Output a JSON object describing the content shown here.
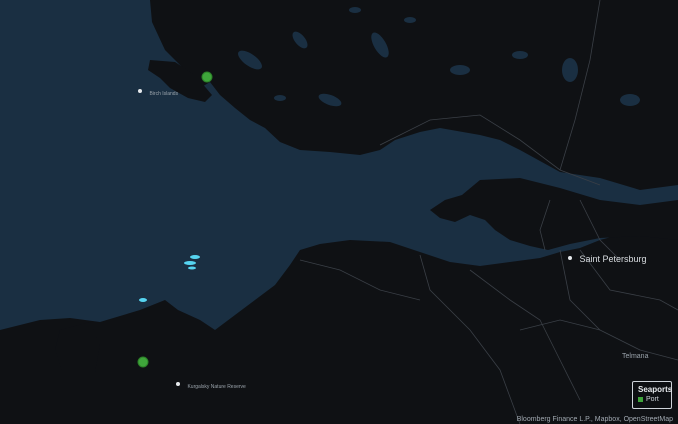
{
  "places": [
    {
      "id": "birch-islands",
      "label": "Birch Islands",
      "size": "small"
    },
    {
      "id": "kurgalsky-reserve",
      "label": "Kurgalsky Nature Reserve",
      "size": "small"
    },
    {
      "id": "saint-petersburg",
      "label": "Saint Petersburg",
      "size": "big"
    },
    {
      "id": "telmana",
      "label": "Telmana",
      "size": "small-plain"
    }
  ],
  "ports": [
    {
      "id": "port-north",
      "category": "Port"
    },
    {
      "id": "port-south",
      "category": "Port"
    }
  ],
  "legend": {
    "title": "Seaports",
    "items": [
      {
        "label": "Port",
        "color": "#3fa53b"
      }
    ]
  },
  "attribution": "Bloomberg Finance L.P., Mapbox, OpenStreetMap",
  "colors": {
    "water": "#1a2f42",
    "land": "#0f1114",
    "road": "#3a3f46",
    "shallow": "#56d4f0",
    "port": "#3fa53b"
  }
}
